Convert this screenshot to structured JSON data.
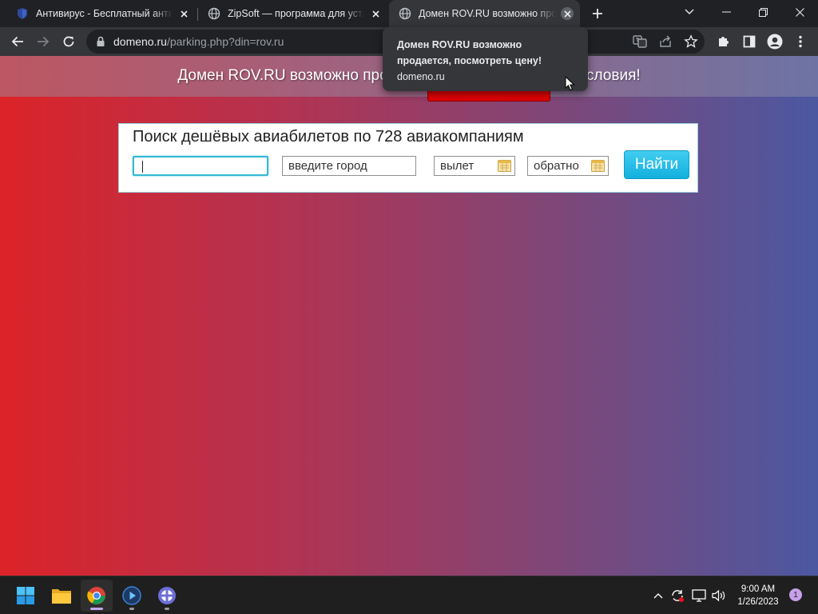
{
  "browser": {
    "tabs": [
      {
        "title": "Антивирус - Бесплатный антивирус",
        "active": false
      },
      {
        "title": "ZipSoft — программа для установки",
        "active": false
      },
      {
        "title": "Домен ROV.RU возможно продается",
        "active": true
      }
    ],
    "address": {
      "host": "domeno.ru",
      "path": "/parking.php?din=rov.ru"
    },
    "tooltip": {
      "title": "Домен ROV.RU возможно продается, посмотреть цену!",
      "url": "domeno.ru"
    }
  },
  "page": {
    "banner_text": "Домен ROV.RU возможно продается, посмотреть цену и условия!",
    "search": {
      "title": "Поиск дешёвых авиабилетов по 728 авиакомпаниям",
      "from_value": "",
      "to_placeholder": "введите город",
      "depart_placeholder": "вылет",
      "return_placeholder": "обратно",
      "submit_label": "Найти"
    },
    "colors": {
      "gradient_left": "#dc2328",
      "gradient_right": "#4b58a1",
      "button": "#13b0de"
    }
  },
  "taskbar": {
    "clock_time": "9:00 AM",
    "clock_date": "1/26/2023",
    "notification_count": "1"
  }
}
